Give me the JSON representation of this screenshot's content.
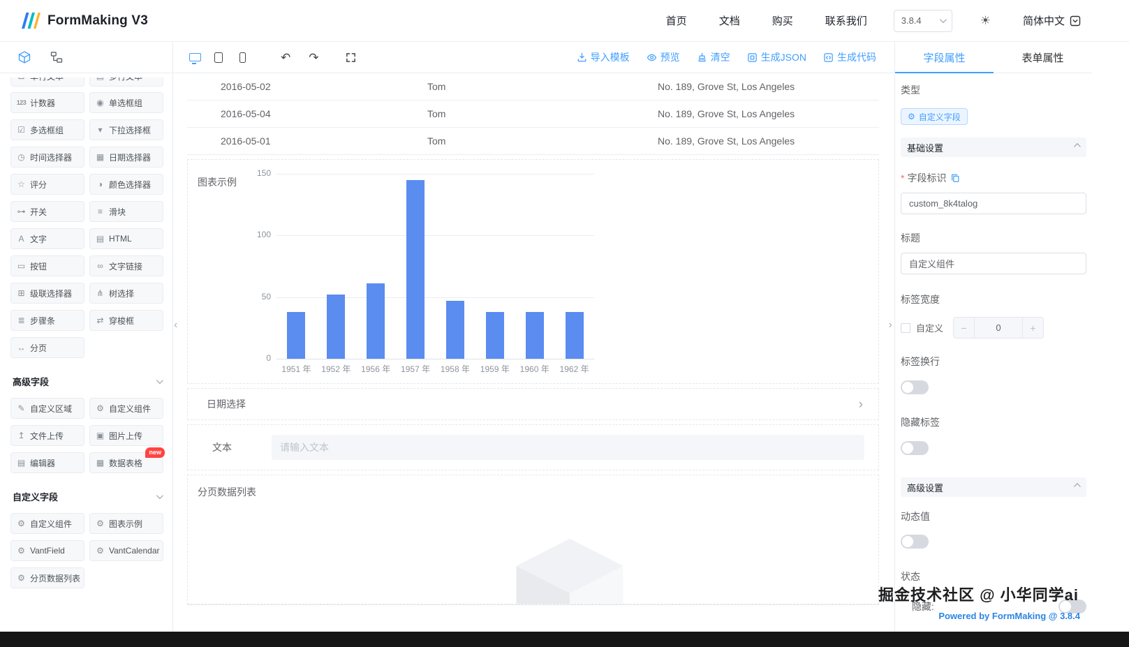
{
  "header": {
    "logo_text": "FormMaking V3",
    "nav": [
      {
        "name": "home",
        "label": "首页"
      },
      {
        "name": "docs",
        "label": "文档"
      },
      {
        "name": "buy",
        "label": "购买"
      },
      {
        "name": "contact",
        "label": "联系我们"
      }
    ],
    "version": "3.8.4",
    "language": "简体中文"
  },
  "sidebar": {
    "partial_fields": [
      {
        "name": "single-line-text",
        "icon": "input-icon",
        "label": "单行文本"
      },
      {
        "name": "multi-line-text",
        "icon": "textarea-icon",
        "label": "多行文本"
      }
    ],
    "basic_fields": [
      {
        "name": "counter",
        "icon": "counter-icon",
        "label": "计数器"
      },
      {
        "name": "radio-group",
        "icon": "radio-icon",
        "label": "单选框组"
      },
      {
        "name": "checkbox-group",
        "icon": "checkbox-icon",
        "label": "多选框组"
      },
      {
        "name": "select",
        "icon": "dropdown-icon",
        "label": "下拉选择框"
      },
      {
        "name": "time-picker",
        "icon": "time-icon",
        "label": "时间选择器"
      },
      {
        "name": "date-picker",
        "icon": "date-icon",
        "label": "日期选择器"
      },
      {
        "name": "rate",
        "icon": "rate-icon",
        "label": "评分"
      },
      {
        "name": "color-picker",
        "icon": "color-icon",
        "label": "颜色选择器"
      },
      {
        "name": "switch",
        "icon": "switch-icon",
        "label": "开关"
      },
      {
        "name": "slider",
        "icon": "slider-icon",
        "label": "滑块"
      },
      {
        "name": "text",
        "icon": "text-icon",
        "label": "文字"
      },
      {
        "name": "html",
        "icon": "html-icon",
        "label": "HTML"
      },
      {
        "name": "button",
        "icon": "button-icon",
        "label": "按钮"
      },
      {
        "name": "text-link",
        "icon": "link-icon",
        "label": "文字链接"
      },
      {
        "name": "cascader",
        "icon": "cascader-icon",
        "label": "级联选择器"
      },
      {
        "name": "tree-select",
        "icon": "tree-icon",
        "label": "树选择"
      },
      {
        "name": "steps",
        "icon": "steps-icon",
        "label": "步骤条"
      },
      {
        "name": "transfer",
        "icon": "transfer-icon",
        "label": "穿梭框"
      },
      {
        "name": "pagination",
        "icon": "pagination-icon",
        "label": "分页"
      }
    ],
    "advanced_section": {
      "title": "高级字段",
      "items": [
        {
          "name": "custom-area",
          "icon": "custom-area-icon",
          "label": "自定义区域"
        },
        {
          "name": "custom-component",
          "icon": "custom-component-icon",
          "label": "自定义组件"
        },
        {
          "name": "file-upload",
          "icon": "file-upload-icon",
          "label": "文件上传"
        },
        {
          "name": "image-upload",
          "icon": "image-upload-icon",
          "label": "图片上传"
        },
        {
          "name": "editor",
          "icon": "editor-icon",
          "label": "编辑器"
        },
        {
          "name": "data-table",
          "icon": "data-table-icon",
          "label": "数据表格",
          "badge": "new"
        }
      ]
    },
    "custom_section": {
      "title": "自定义字段",
      "items": [
        {
          "name": "custom-component",
          "icon": "plugin-icon",
          "label": "自定义组件"
        },
        {
          "name": "chart-demo",
          "icon": "plugin-icon",
          "label": "图表示例"
        },
        {
          "name": "vant-field",
          "icon": "plugin-icon",
          "label": "VantField"
        },
        {
          "name": "vant-calendar",
          "icon": "plugin-icon",
          "label": "VantCalendar"
        },
        {
          "name": "paged-data-list",
          "icon": "plugin-icon",
          "label": "分页数据列表"
        }
      ]
    }
  },
  "toolbar": {
    "actions": [
      {
        "name": "import-template",
        "icon": "import-icon",
        "label": "导入模板"
      },
      {
        "name": "preview",
        "icon": "preview-icon",
        "label": "预览"
      },
      {
        "name": "clear",
        "icon": "clear-icon",
        "label": "清空"
      },
      {
        "name": "generate-json",
        "icon": "json-icon",
        "label": "生成JSON"
      },
      {
        "name": "generate-code",
        "icon": "code-icon",
        "label": "生成代码"
      }
    ]
  },
  "canvas": {
    "table_rows": [
      {
        "date": "2016-05-02",
        "name": "Tom",
        "address": "No. 189, Grove St, Los Angeles"
      },
      {
        "date": "2016-05-04",
        "name": "Tom",
        "address": "No. 189, Grove St, Los Angeles"
      },
      {
        "date": "2016-05-01",
        "name": "Tom",
        "address": "No. 189, Grove St, Los Angeles"
      }
    ],
    "chart_label": "图表示例",
    "date_select_label": "日期选择",
    "text_field": {
      "label": "文本",
      "placeholder": "请输入文本"
    },
    "pagination_list_label": "分页数据列表"
  },
  "chart_data": {
    "type": "bar",
    "title": "图表示例",
    "categories": [
      "1951 年",
      "1952 年",
      "1956 年",
      "1957 年",
      "1958 年",
      "1959 年",
      "1960 年",
      "1962 年"
    ],
    "values": [
      38,
      52,
      61,
      145,
      47,
      38,
      38,
      38
    ],
    "ylim": [
      0,
      150
    ],
    "yticks": [
      0,
      50,
      100,
      150
    ],
    "grid": true,
    "legend": "none",
    "bar_color": "#5B8CF0"
  },
  "properties": {
    "tabs": [
      {
        "name": "field-props",
        "label": "字段属性",
        "active": true
      },
      {
        "name": "form-props",
        "label": "表单属性",
        "active": false
      }
    ],
    "type_label": "类型",
    "type_tag": "自定义字段",
    "basic": {
      "title": "基础设置",
      "field_id_label": "字段标识",
      "field_id_value": "custom_8k4talog",
      "title_label": "标题",
      "title_value": "自定义组件",
      "label_width_label": "标签宽度",
      "custom_checkbox_label": "自定义",
      "stepper_value": "0",
      "label_wrap_label": "标签换行",
      "hide_label_label": "隐藏标签"
    },
    "advanced": {
      "title": "高级设置",
      "dynamic_value_label": "动态值",
      "status_label": "状态",
      "hidden_label": "隐藏:"
    }
  },
  "footer": {
    "watermark": "掘金技术社区 @ 小华同学ai",
    "powered_by": "Powered by FormMaking @ 3.8.4"
  }
}
